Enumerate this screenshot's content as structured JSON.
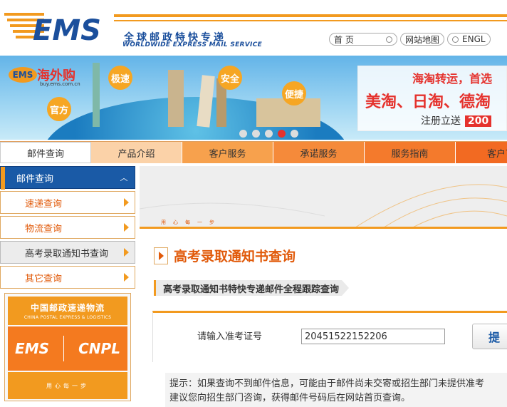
{
  "header": {
    "logo_text": "EMS",
    "tagline_cn": "全球邮政特快专递",
    "tagline_en": "WORLDWIDE EXPRESS MAIL SERVICE",
    "links": {
      "home": "首 页",
      "sitemap": "网站地图",
      "english": "ENGL"
    }
  },
  "banner": {
    "logo_ems": "EMS",
    "logo_cn": "海外购",
    "logo_url": "buy.ems.com.cn",
    "bubbles": [
      "官方",
      "极速",
      "安全",
      "便捷"
    ],
    "promo_line1": "海淘转运，首选",
    "promo_line2": "美淘、日淘、德淘",
    "promo_line3": "注册立送",
    "promo_amount": "200"
  },
  "nav": {
    "items": [
      {
        "label": "邮件查询"
      },
      {
        "label": "产品介绍"
      },
      {
        "label": "客户服务"
      },
      {
        "label": "承诺服务"
      },
      {
        "label": "服务指南"
      },
      {
        "label": "客户下"
      }
    ]
  },
  "sidebar": {
    "header": "邮件查询",
    "items": [
      {
        "label": "速递查询"
      },
      {
        "label": "物流查询"
      },
      {
        "label": "高考录取通知书查询"
      },
      {
        "label": "其它查询"
      }
    ],
    "brand_cn": "中国邮政速递物流",
    "brand_en": "CHINA POSTAL EXPRESS & LOGISTICS",
    "brand_ems": "EMS",
    "brand_cnpl": "CNPL",
    "brand_slogan": "用心每一步"
  },
  "main": {
    "slogan": "用心每一步",
    "title": "高考录取通知书查询",
    "subtitle": "高考录取通知书特快专递邮件全程跟踪查询",
    "form": {
      "label": "请输入准考证号",
      "value": "20451522152206",
      "button": "提"
    },
    "tip_line1": "提示：如果查询不到邮件信息，可能由于邮件尚未交寄或招生部门未提供准考",
    "tip_line2": "建议您向招生部门咨询，获得邮件号码后在网站首页查询。"
  },
  "colors": {
    "orange": "#f29a1f",
    "blue": "#1a5aa6",
    "red": "#e5322d"
  }
}
